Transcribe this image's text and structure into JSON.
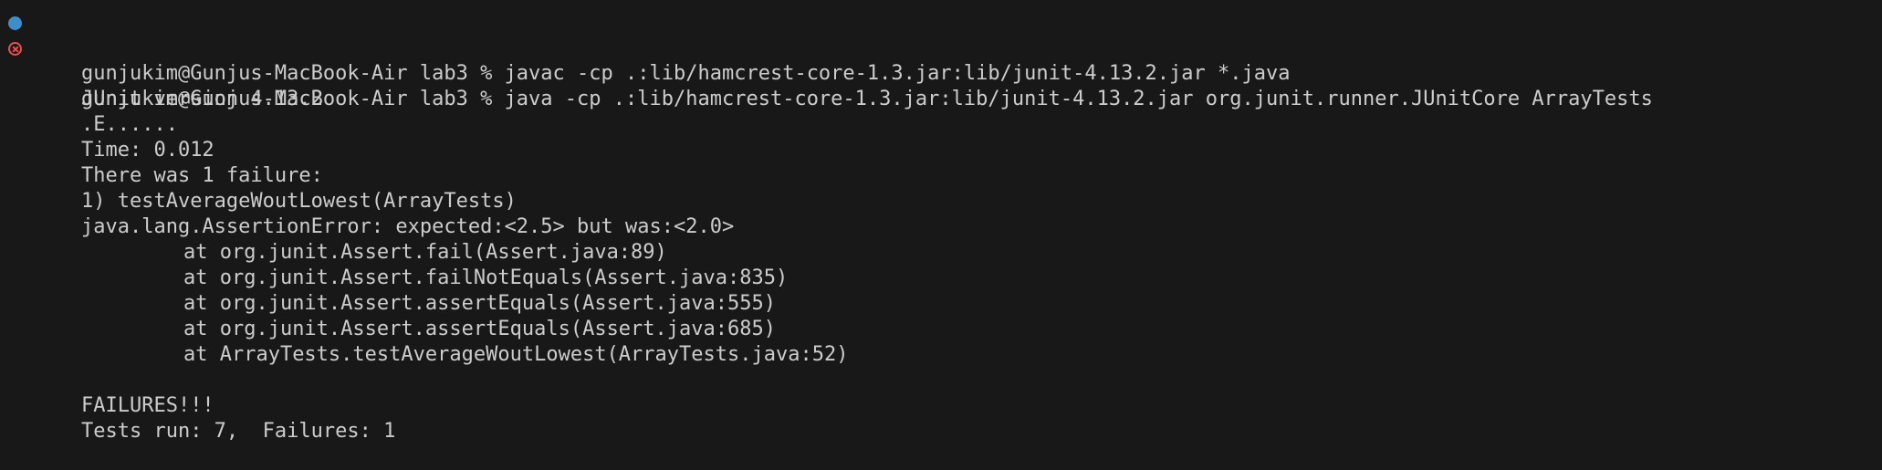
{
  "terminal": {
    "commands": [
      {
        "status": "success",
        "text": "gunjukim@Gunjus-MacBook-Air lab3 % javac -cp .:lib/hamcrest-core-1.3.jar:lib/junit-4.13.2.jar *.java"
      },
      {
        "status": "error",
        "text": "gunjukim@Gunjus-MacBook-Air lab3 % java -cp .:lib/hamcrest-core-1.3.jar:lib/junit-4.13.2.jar org.junit.runner.JUnitCore ArrayTests"
      }
    ],
    "output": [
      "JUnit version 4.13.2",
      ".E......",
      "Time: 0.012",
      "There was 1 failure:",
      "1) testAverageWoutLowest(ArrayTests)",
      "java.lang.AssertionError: expected:<2.5> but was:<2.0>"
    ],
    "stack_trace": [
      "at org.junit.Assert.fail(Assert.java:89)",
      "at org.junit.Assert.failNotEquals(Assert.java:835)",
      "at org.junit.Assert.assertEquals(Assert.java:555)",
      "at org.junit.Assert.assertEquals(Assert.java:685)",
      "at ArrayTests.testAverageWoutLowest(ArrayTests.java:52)"
    ],
    "summary": [
      "FAILURES!!!",
      "Tests run: 7,  Failures: 1"
    ]
  }
}
